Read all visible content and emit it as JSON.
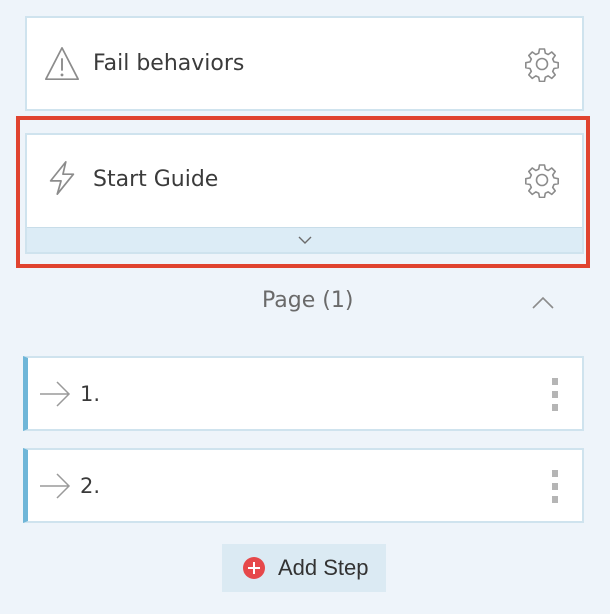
{
  "cards": {
    "fail": {
      "label": "Fail behaviors",
      "icon": "warning-icon"
    },
    "start": {
      "label": "Start Guide",
      "icon": "lightning-icon"
    }
  },
  "section": {
    "title": "Page (1)"
  },
  "steps": [
    {
      "label": "1."
    },
    {
      "label": "2."
    }
  ],
  "actions": {
    "add_step_label": "Add Step"
  },
  "colors": {
    "highlight": "#e0432f",
    "accent": "#6fb6d8",
    "add_icon": "#e6484a"
  }
}
